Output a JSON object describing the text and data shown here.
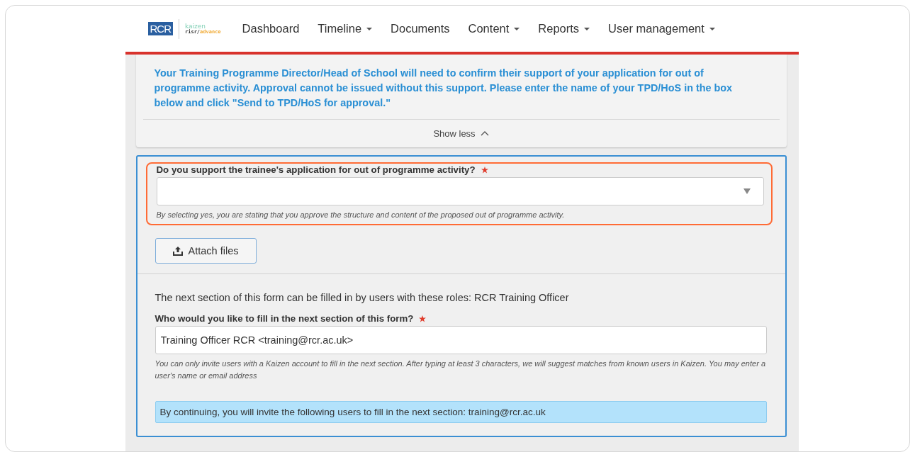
{
  "header": {
    "logo": {
      "mark": "RCR",
      "brand": "kaizen",
      "product_prefix": "risr/",
      "product_suffix": "advance"
    },
    "nav": [
      {
        "label": "Dashboard",
        "dropdown": false
      },
      {
        "label": "Timeline",
        "dropdown": true
      },
      {
        "label": "Documents",
        "dropdown": false
      },
      {
        "label": "Content",
        "dropdown": true
      },
      {
        "label": "Reports",
        "dropdown": true
      },
      {
        "label": "User management",
        "dropdown": true
      }
    ]
  },
  "info_card": {
    "text": "Your Training Programme Director/Head of School will need to confirm their support of your application for out of programme activity. Approval cannot be issued without this support. Please enter the name of your TPD/HoS in the box below and click \"Send to TPD/HoS for approval.\"",
    "toggle": "Show less"
  },
  "form": {
    "support_question": {
      "label": "Do you support the trainee's application for out of programme activity?",
      "required": true,
      "highlighted": true,
      "hint": "By selecting yes, you are stating that you approve the structure and content of the proposed out of programme activity."
    },
    "attach_button": "Attach files",
    "next_section_note": "The next section of this form can be filled in by users with these roles: RCR Training Officer",
    "invite": {
      "label": "Who would you like to fill in the next section of this form?",
      "required": true,
      "value": "Training Officer RCR <training@rcr.ac.uk>",
      "hint": "You can only invite users with a Kaizen account to fill in the next section. After typing at least 3 characters, we will suggest matches from known users in Kaizen. You may enter a user's name or email address"
    },
    "notice": "By continuing, you will invite the following users to fill in the next section: training@rcr.ac.uk"
  }
}
